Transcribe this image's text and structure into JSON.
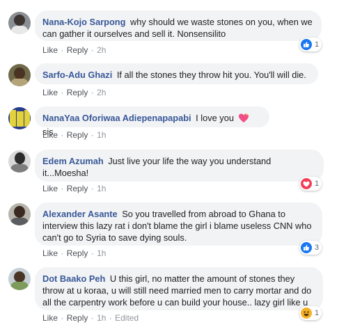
{
  "comments": [
    {
      "author": "Nana-Kojo Sarpong",
      "text": "why should we waste stones on you, when we can gather it ourselves and sell it. Nonsensilito",
      "like": "Like",
      "reply": "Reply",
      "time": "2h",
      "reaction": {
        "icon": "like-icon",
        "count": "1",
        "color": "#1877f2"
      }
    },
    {
      "author": "Sarfo-Adu Ghazi",
      "text": "If all the stones they throw hit you. You'll will die.",
      "like": "Like",
      "reply": "Reply",
      "time": "2h"
    },
    {
      "author": "NanaYaa Oforiwaa Adiepenapapabi",
      "text_before": "I love you",
      "text_after": "sis",
      "emoji": "sparkling-heart-icon",
      "like": "Like",
      "reply": "Reply",
      "time": "1h"
    },
    {
      "author": "Edem Azumah",
      "text": "Just live your life the way you understand it...Moesha!",
      "like": "Like",
      "reply": "Reply",
      "time": "1h",
      "reaction": {
        "icon": "love-icon",
        "count": "1",
        "color": "#f33e58"
      }
    },
    {
      "author": "Alexander Asante",
      "text": "So you travelled from abroad to Ghana to interview this lazy rat i don't blame the girl i blame useless CNN who can't go to Syria to save dying souls.",
      "like": "Like",
      "reply": "Reply",
      "time": "1h",
      "reaction": {
        "icon": "like-icon",
        "count": "3",
        "color": "#1877f2"
      }
    },
    {
      "author": "Dot Baako Peh",
      "text": "U this girl, no matter the amount of stones they throw at u koraa, u will still need married men to carry mortar and do all the carpentry work before u can build your house.. lazy girl like u",
      "like": "Like",
      "reply": "Reply",
      "time": "1h",
      "edited": "Edited",
      "reaction": {
        "icon": "haha-icon",
        "count": "1",
        "color": "#f7b125"
      }
    }
  ],
  "separator": "·"
}
